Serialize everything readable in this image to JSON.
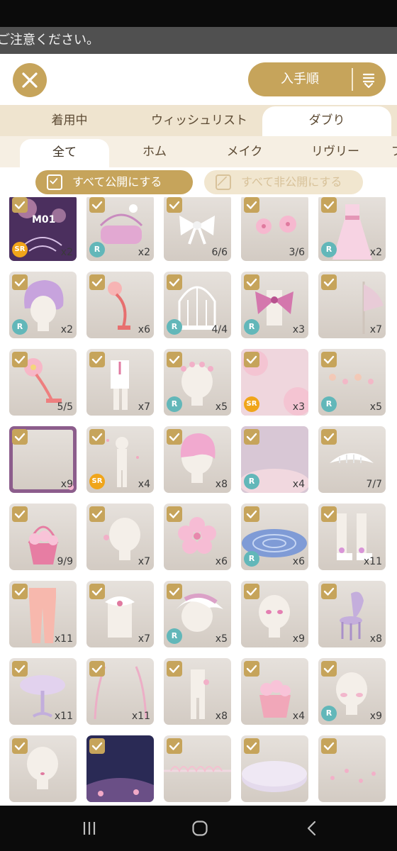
{
  "notice": {
    "text": "ご注意ください。"
  },
  "header": {
    "close_icon": "close-icon",
    "sort_label": "入手順",
    "sort_icon": "sort-icon"
  },
  "main_tabs": [
    "着用中",
    "ウィッシュリスト",
    "ダブり"
  ],
  "main_tab_active": "ダブり",
  "sub_tabs": [
    "全て",
    "ホム",
    "メイク",
    "リヴリー",
    "フ"
  ],
  "sub_tab_active": "全て",
  "bulk": {
    "public_label": "すべて公開にする",
    "private_label": "すべて非公開にする"
  },
  "colors": {
    "accent": "#c6a45b",
    "rarity_r": "#62b7b9",
    "rarity_sr": "#f0a51a",
    "tab_bg": "#efe4cf"
  },
  "items": [
    {
      "art": "bg-m01",
      "rarity": "SR",
      "count": "x2",
      "label": "M01"
    },
    {
      "art": "pink-bench",
      "rarity": "R",
      "count": "x2"
    },
    {
      "art": "white-bow",
      "rarity": "",
      "count": "6/6"
    },
    {
      "art": "pink-flowers",
      "rarity": "",
      "count": "3/6"
    },
    {
      "art": "pink-dress",
      "rarity": "R",
      "count": "x2"
    },
    {
      "art": "lilac-hair",
      "rarity": "R",
      "count": "x2"
    },
    {
      "art": "flower-lamp",
      "rarity": "",
      "count": "x6"
    },
    {
      "art": "birdcage",
      "rarity": "R",
      "count": "4/4"
    },
    {
      "art": "bow-outfit",
      "rarity": "R",
      "count": "x3"
    },
    {
      "art": "flag",
      "rarity": "",
      "count": "x7"
    },
    {
      "art": "flower-lamp-2",
      "rarity": "",
      "count": "5/5"
    },
    {
      "art": "white-outfit",
      "rarity": "",
      "count": "x7"
    },
    {
      "art": "flower-crown",
      "rarity": "R",
      "count": "x5"
    },
    {
      "art": "pink-glow-bg",
      "rarity": "SR",
      "count": "x3"
    },
    {
      "art": "bokeh",
      "rarity": "R",
      "count": "x5"
    },
    {
      "art": "frame",
      "rarity": "",
      "count": "x9"
    },
    {
      "art": "petal-figure",
      "rarity": "SR",
      "count": "x4"
    },
    {
      "art": "pink-hair",
      "rarity": "",
      "count": "x8"
    },
    {
      "art": "mist-bg",
      "rarity": "R",
      "count": "x4"
    },
    {
      "art": "tiara",
      "rarity": "",
      "count": "7/7"
    },
    {
      "art": "flower-basket",
      "rarity": "",
      "count": "9/9"
    },
    {
      "art": "head-flower",
      "rarity": "",
      "count": "x7"
    },
    {
      "art": "sakura",
      "rarity": "",
      "count": "x6"
    },
    {
      "art": "water-floor",
      "rarity": "R",
      "count": "x6"
    },
    {
      "art": "socks",
      "rarity": "",
      "count": "x11"
    },
    {
      "art": "pink-pants",
      "rarity": "",
      "count": "x11"
    },
    {
      "art": "collar-outfit",
      "rarity": "",
      "count": "x7"
    },
    {
      "art": "bonnet",
      "rarity": "R",
      "count": "x5"
    },
    {
      "art": "pink-eyes",
      "rarity": "",
      "count": "x9"
    },
    {
      "art": "chair",
      "rarity": "",
      "count": "x8"
    },
    {
      "art": "table",
      "rarity": "",
      "count": "x11"
    },
    {
      "art": "wings",
      "rarity": "",
      "count": "x11"
    },
    {
      "art": "pink-jumpsuit",
      "rarity": "",
      "count": "x8"
    },
    {
      "art": "flower-basket-2",
      "rarity": "",
      "count": "x4"
    },
    {
      "art": "blush",
      "rarity": "R",
      "count": "x9"
    },
    {
      "art": "head-lip",
      "rarity": "",
      "count": ""
    },
    {
      "art": "night-bg",
      "rarity": "",
      "count": ""
    },
    {
      "art": "lace-fence",
      "rarity": "",
      "count": ""
    },
    {
      "art": "stage",
      "rarity": "",
      "count": ""
    },
    {
      "art": "petals-floor",
      "rarity": "",
      "count": ""
    }
  ],
  "navbar": {
    "recents_icon": "recents-icon",
    "home_icon": "home-icon",
    "back_icon": "back-icon"
  }
}
